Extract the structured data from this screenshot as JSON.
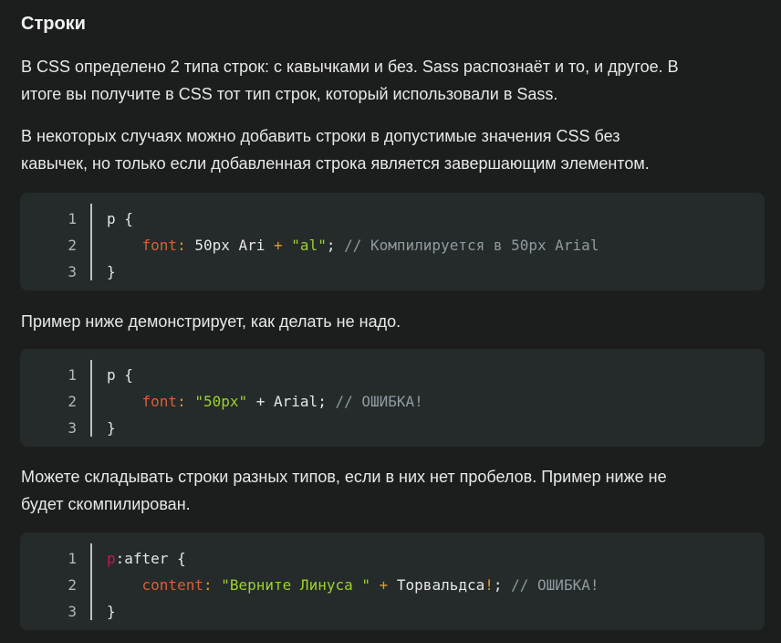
{
  "heading": "Строки",
  "paragraphs": {
    "p1": [
      "В CSS определено 2 типа строк: с кавычками и без. Sass распознаёт и то, и другое. В",
      "итоге вы получите в CSS тот тип строк, который использовали в Sass."
    ],
    "p2": [
      "В некоторых случаях можно добавить строки в допустимые значения CSS без",
      "кавычек, но только если добавленная строка является завершающим элементом."
    ],
    "p3": [
      "Пример ниже демонстрирует, как делать не надо."
    ],
    "p4": [
      "Можете складывать строки разных типов, если в них нет пробелов. Пример ниже не",
      "будет скомпилирован."
    ]
  },
  "code_blocks": [
    {
      "line_numbers": [
        "1",
        "2",
        "3"
      ],
      "lines": [
        [
          {
            "t": "p {",
            "c": "plain"
          }
        ],
        [
          {
            "t": "    ",
            "c": "plain"
          },
          {
            "t": "font",
            "c": "prop"
          },
          {
            "t": ": ",
            "c": "op"
          },
          {
            "t": "50px Ari ",
            "c": "plain"
          },
          {
            "t": "+ ",
            "c": "op"
          },
          {
            "t": "\"al\"",
            "c": "str"
          },
          {
            "t": "; ",
            "c": "plain"
          },
          {
            "t": "// Компилируется в 50px Arial",
            "c": "com"
          }
        ],
        [
          {
            "t": "}",
            "c": "plain"
          }
        ]
      ]
    },
    {
      "line_numbers": [
        "1",
        "2",
        "3"
      ],
      "lines": [
        [
          {
            "t": "p {",
            "c": "plain"
          }
        ],
        [
          {
            "t": "    ",
            "c": "plain"
          },
          {
            "t": "font",
            "c": "prop"
          },
          {
            "t": ": ",
            "c": "op"
          },
          {
            "t": "\"50px\"",
            "c": "str"
          },
          {
            "t": " + Arial; ",
            "c": "plain"
          },
          {
            "t": "// ОШИБКА!",
            "c": "com"
          }
        ],
        [
          {
            "t": "}",
            "c": "plain"
          }
        ]
      ]
    },
    {
      "line_numbers": [
        "1",
        "2",
        "3"
      ],
      "lines": [
        [
          {
            "t": "p",
            "c": "sel"
          },
          {
            "t": ":after {",
            "c": "plain"
          }
        ],
        [
          {
            "t": "    ",
            "c": "plain"
          },
          {
            "t": "content",
            "c": "prop"
          },
          {
            "t": ": ",
            "c": "op"
          },
          {
            "t": "\"Верните Линуса \"",
            "c": "str"
          },
          {
            "t": " + ",
            "c": "op"
          },
          {
            "t": "Торвальдса",
            "c": "plain"
          },
          {
            "t": "!",
            "c": "op"
          },
          {
            "t": "; ",
            "c": "plain"
          },
          {
            "t": "// ОШИБКА!",
            "c": "com"
          }
        ],
        [
          {
            "t": "}",
            "c": "plain"
          }
        ]
      ]
    }
  ],
  "colors": {
    "background": "#1c1e1e",
    "code_background": "#252a2b",
    "property": "#d95f34",
    "selector": "#c2185b",
    "string": "#9cd22d",
    "operator": "#e39a2c",
    "comment": "#8f9ba0"
  }
}
